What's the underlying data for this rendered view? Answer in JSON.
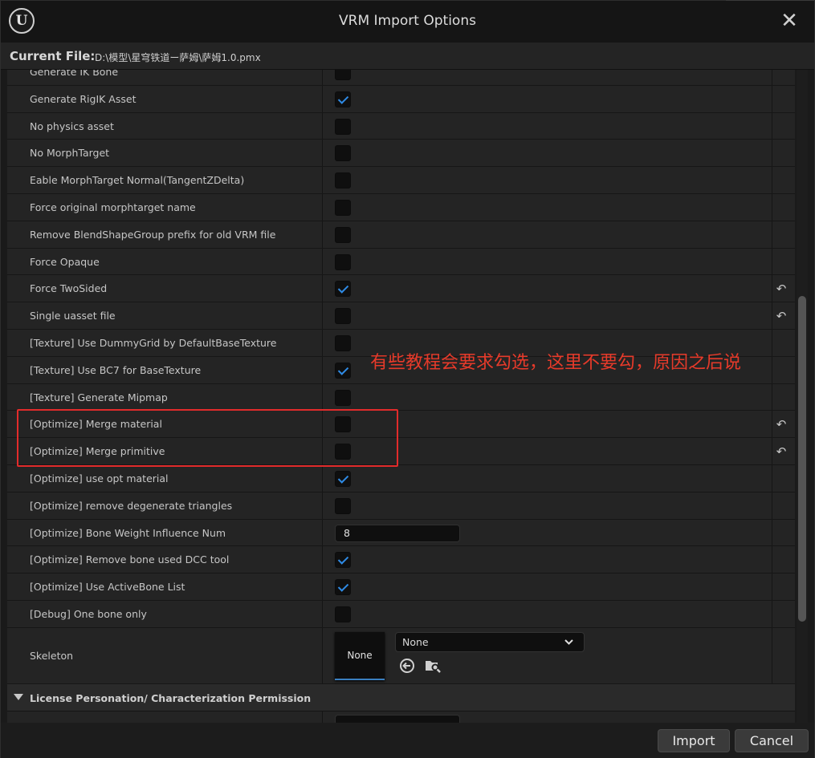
{
  "window": {
    "title": "VRM Import Options",
    "logo_letter": "U"
  },
  "file": {
    "label": "Current File:",
    "path": "D:\\模型\\星穹铁道ー萨姆\\萨姆1.0.pmx"
  },
  "options": [
    {
      "label": "Generate IK Bone",
      "type": "checkbox",
      "checked": false,
      "reset": false
    },
    {
      "label": "Generate RigIK Asset",
      "type": "checkbox",
      "checked": true,
      "reset": false
    },
    {
      "label": "No physics asset",
      "type": "checkbox",
      "checked": false,
      "reset": false
    },
    {
      "label": "No MorphTarget",
      "type": "checkbox",
      "checked": false,
      "reset": false
    },
    {
      "label": "Eable MorphTarget Normal(TangentZDelta)",
      "type": "checkbox",
      "checked": false,
      "reset": false
    },
    {
      "label": "Force original morphtarget name",
      "type": "checkbox",
      "checked": false,
      "reset": false
    },
    {
      "label": "Remove BlendShapeGroup prefix for old VRM file",
      "type": "checkbox",
      "checked": false,
      "reset": false
    },
    {
      "label": "Force Opaque",
      "type": "checkbox",
      "checked": false,
      "reset": false
    },
    {
      "label": "Force TwoSided",
      "type": "checkbox",
      "checked": true,
      "reset": true
    },
    {
      "label": "Single uasset file",
      "type": "checkbox",
      "checked": false,
      "reset": true
    },
    {
      "label": "[Texture] Use DummyGrid by DefaultBaseTexture",
      "type": "checkbox",
      "checked": false,
      "reset": false
    },
    {
      "label": "[Texture] Use BC7 for BaseTexture",
      "type": "checkbox",
      "checked": true,
      "reset": false
    },
    {
      "label": "[Texture] Generate Mipmap",
      "type": "checkbox",
      "checked": false,
      "reset": false
    },
    {
      "label": "[Optimize] Merge material",
      "type": "checkbox",
      "checked": false,
      "reset": true
    },
    {
      "label": "[Optimize] Merge primitive",
      "type": "checkbox",
      "checked": false,
      "reset": true
    },
    {
      "label": "[Optimize] use opt material",
      "type": "checkbox",
      "checked": true,
      "reset": false
    },
    {
      "label": "[Optimize] remove degenerate triangles",
      "type": "checkbox",
      "checked": false,
      "reset": false
    },
    {
      "label": "[Optimize] Bone Weight Influence Num",
      "type": "number",
      "value": "8",
      "reset": false
    },
    {
      "label": "[Optimize] Remove bone used DCC tool",
      "type": "checkbox",
      "checked": true,
      "reset": false
    },
    {
      "label": "[Optimize] Use ActiveBone List",
      "type": "checkbox",
      "checked": true,
      "reset": false
    },
    {
      "label": "[Debug] One bone only",
      "type": "checkbox",
      "checked": false,
      "reset": false
    }
  ],
  "skeleton": {
    "label": "Skeleton",
    "thumb_text": "None",
    "selected": "None",
    "icons": [
      "browse-back-icon",
      "find-in-browser-icon"
    ]
  },
  "section": {
    "title": "License Personation/ Characterization Permission"
  },
  "annotation": {
    "text": "有些教程会要求勾选，这里不要勾，原因之后说",
    "color": "#e63a2a"
  },
  "footer": {
    "import_label": "Import",
    "cancel_label": "Cancel"
  },
  "colors": {
    "accent": "#2f8be6",
    "highlight": "#e22b2b"
  }
}
